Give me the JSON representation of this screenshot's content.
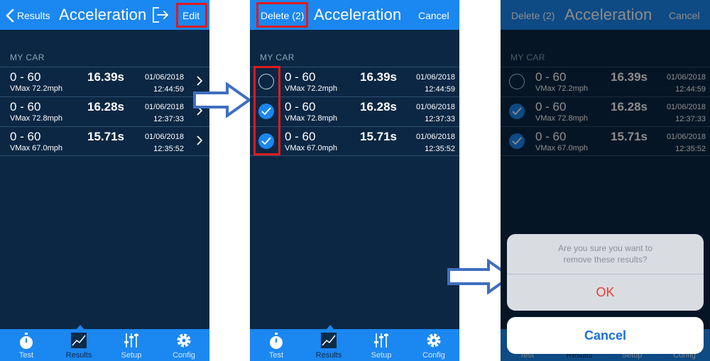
{
  "colors": {
    "nav_blue": "#1b87f1",
    "background": "#0b2744",
    "highlight_red": "#e01b1b",
    "arrow_blue": "#3f6fbf",
    "destructive_red": "#f03b30"
  },
  "screen1": {
    "nav": {
      "back_label": "Results",
      "title": "Acceleration",
      "edit_label": "Edit",
      "share_icon": "share-icon"
    },
    "section_header": "MY CAR",
    "rows": [
      {
        "title": "0 - 60",
        "vmax": "VMax 72.2mph",
        "time": "16.39s",
        "date": "01/06/2018",
        "clock": "12:44:59"
      },
      {
        "title": "0 - 60",
        "vmax": "VMax 72.8mph",
        "time": "16.28s",
        "date": "01/06/2018",
        "clock": "12:37:33"
      },
      {
        "title": "0 - 60",
        "vmax": "VMax 67.0mph",
        "time": "15.71s",
        "date": "01/06/2018",
        "clock": "12:35:52"
      }
    ]
  },
  "screen2": {
    "nav": {
      "delete_label": "Delete (2)",
      "title": "Acceleration",
      "cancel_label": "Cancel"
    },
    "section_header": "MY CAR",
    "rows": [
      {
        "checked": false,
        "title": "0 - 60",
        "vmax": "VMax 72.2mph",
        "time": "16.39s",
        "date": "01/06/2018",
        "clock": "12:44:59"
      },
      {
        "checked": true,
        "title": "0 - 60",
        "vmax": "VMax 72.8mph",
        "time": "16.28s",
        "date": "01/06/2018",
        "clock": "12:37:33"
      },
      {
        "checked": true,
        "title": "0 - 60",
        "vmax": "VMax 67.0mph",
        "time": "15.71s",
        "date": "01/06/2018",
        "clock": "12:35:52"
      }
    ]
  },
  "screen3": {
    "nav": {
      "delete_label": "Delete (2)",
      "title": "Acceleration",
      "cancel_label": "Cancel"
    },
    "section_header": "MY CAR",
    "rows": [
      {
        "checked": false,
        "title": "0 - 60",
        "vmax": "VMax 72.2mph",
        "time": "16.39s",
        "date": "01/06/2018",
        "clock": "12:44:59"
      },
      {
        "checked": true,
        "title": "0 - 60",
        "vmax": "VMax 72.8mph",
        "time": "16.28s",
        "date": "01/06/2018",
        "clock": "12:37:33"
      },
      {
        "checked": true,
        "title": "0 - 60",
        "vmax": "VMax 67.0mph",
        "time": "15.71s",
        "date": "01/06/2018",
        "clock": "12:35:52"
      }
    ],
    "alert": {
      "message": "Are you sure you want to remove these results?",
      "ok_label": "OK",
      "cancel_label": "Cancel"
    }
  },
  "tabbar": {
    "selected": "Results",
    "tabs": [
      {
        "label": "Test",
        "icon": "stopwatch-icon"
      },
      {
        "label": "Results",
        "icon": "chart-icon"
      },
      {
        "label": "Setup",
        "icon": "sliders-icon"
      },
      {
        "label": "Config",
        "icon": "gear-icon"
      }
    ]
  }
}
